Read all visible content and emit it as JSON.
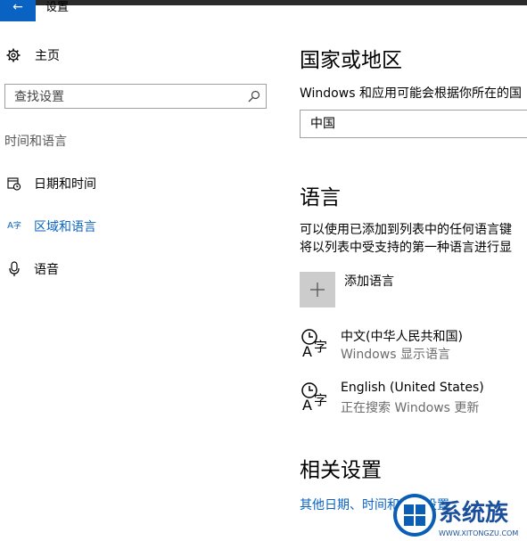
{
  "window": {
    "title": "设置",
    "back_icon": "back-arrow-icon"
  },
  "sidebar": {
    "home_label": "主页",
    "search_placeholder": "查找设置",
    "section_title": "时间和语言",
    "items": [
      {
        "label": "日期和时间",
        "icon": "calendar-clock-icon",
        "active": false
      },
      {
        "label": "区域和语言",
        "icon": "language-icon",
        "active": true
      },
      {
        "label": "语音",
        "icon": "microphone-icon",
        "active": false
      }
    ]
  },
  "region": {
    "heading": "国家或地区",
    "description": "Windows 和应用可能会根据你所在的国",
    "selected_country": "中国"
  },
  "language": {
    "heading": "语言",
    "description_line1": "可以使用已添加到列表中的任何语言键",
    "description_line2": "将以列表中受支持的第一种语言进行显",
    "add_label": "添加语言",
    "languages": [
      {
        "name": "中文(中华人民共和国)",
        "status": "Windows 显示语言"
      },
      {
        "name": "English (United States)",
        "status": "正在搜索 Windows 更新"
      }
    ]
  },
  "related": {
    "heading": "相关设置",
    "link": "其他日期、时间和区域设置"
  },
  "watermark": {
    "text": "系统族",
    "url_text": "WWW.XITONGZU.COM"
  },
  "colors": {
    "accent": "#0a63c2",
    "title_bar": "#2b2b2b"
  }
}
